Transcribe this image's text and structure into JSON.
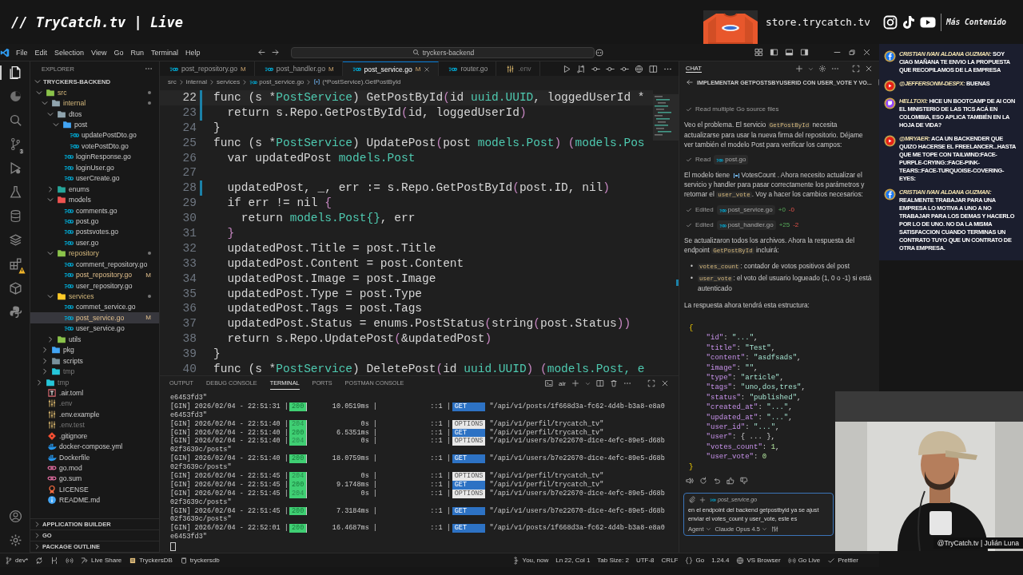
{
  "overlay": {
    "title": "// TryCatch.tv | Live",
    "store": "store.trycatch.tv",
    "more": "Más Contenido"
  },
  "window": {
    "menu": [
      "File",
      "Edit",
      "Selection",
      "View",
      "Go",
      "Run",
      "Terminal",
      "Help"
    ],
    "search": "tryckers-backend"
  },
  "activity_bar": [
    {
      "kind": "files",
      "selected": true,
      "warning": false
    },
    {
      "kind": "pie",
      "selected": false,
      "warning": false
    },
    {
      "kind": "search",
      "selected": false,
      "warning": false
    },
    {
      "kind": "branch",
      "selected": false,
      "badge": "3",
      "warning": false
    },
    {
      "kind": "debug",
      "selected": false,
      "warning": false
    },
    {
      "kind": "flask",
      "selected": false,
      "warning": false
    },
    {
      "kind": "database",
      "selected": false,
      "warning": false
    },
    {
      "kind": "layers",
      "selected": false,
      "warning": false
    },
    {
      "kind": "extensions",
      "selected": false,
      "warning": true
    },
    {
      "kind": "package",
      "selected": false,
      "warning": false
    },
    {
      "kind": "python",
      "selected": false,
      "warning": false
    }
  ],
  "activity_bottom": [
    {
      "kind": "account"
    },
    {
      "kind": "settings"
    }
  ],
  "explorer": {
    "title": "EXPLORER",
    "root": "TRYCKERS-BACKEND",
    "tree": [
      {
        "name": "src",
        "kind": "folder",
        "color": "#8bc34a",
        "expanded": true,
        "dot": true,
        "ignored": false,
        "selected": false,
        "children": [
          {
            "name": "internal",
            "kind": "folder",
            "color": "#90a4ae",
            "expanded": true,
            "dot": true,
            "ignored": false,
            "selected": false,
            "children": [
              {
                "name": "dtos",
                "kind": "folder",
                "color": "#90a4ae",
                "expanded": true,
                "dot": false,
                "ignored": false,
                "selected": false,
                "children": [
                  {
                    "name": "post",
                    "kind": "folder",
                    "color": "#42a5f5",
                    "expanded": true,
                    "dot": false,
                    "ignored": false,
                    "selected": false,
                    "children": [
                      {
                        "name": "updatePostDto.go",
                        "kind": "go",
                        "dot": false,
                        "ignored": false,
                        "selected": false
                      },
                      {
                        "name": "votePostDto.go",
                        "kind": "go",
                        "dot": false,
                        "ignored": false,
                        "selected": false
                      }
                    ]
                  },
                  {
                    "name": "loginResponse.go",
                    "kind": "go",
                    "dot": false,
                    "ignored": false,
                    "selected": false
                  },
                  {
                    "name": "loginUser.go",
                    "kind": "go",
                    "dot": false,
                    "ignored": false,
                    "selected": false
                  },
                  {
                    "name": "userCreate.go",
                    "kind": "go",
                    "dot": false,
                    "ignored": false,
                    "selected": false
                  }
                ]
              },
              {
                "name": "enums",
                "kind": "folder",
                "color": "#26a69a",
                "expanded": false,
                "dot": false,
                "ignored": false,
                "selected": false
              },
              {
                "name": "models",
                "kind": "folder",
                "color": "#ef5350",
                "expanded": true,
                "dot": false,
                "ignored": false,
                "selected": false,
                "children": [
                  {
                    "name": "comments.go",
                    "kind": "go",
                    "dot": false,
                    "ignored": false,
                    "selected": false
                  },
                  {
                    "name": "post.go",
                    "kind": "go",
                    "dot": false,
                    "ignored": false,
                    "selected": false
                  },
                  {
                    "name": "postsvotes.go",
                    "kind": "go",
                    "dot": false,
                    "ignored": false,
                    "selected": false
                  },
                  {
                    "name": "user.go",
                    "kind": "go",
                    "dot": false,
                    "ignored": false,
                    "selected": false
                  }
                ]
              },
              {
                "name": "repository",
                "kind": "folder",
                "color": "#8bc34a",
                "expanded": true,
                "dot": true,
                "ignored": false,
                "selected": false,
                "children": [
                  {
                    "name": "comment_repository.go",
                    "kind": "go",
                    "dot": false,
                    "ignored": false,
                    "selected": false
                  },
                  {
                    "name": "post_repository.go",
                    "kind": "go",
                    "badge": "M",
                    "dot": false,
                    "ignored": false,
                    "selected": false
                  },
                  {
                    "name": "user_repository.go",
                    "kind": "go",
                    "dot": false,
                    "ignored": false,
                    "selected": false
                  }
                ]
              },
              {
                "name": "services",
                "kind": "folder",
                "color": "#ffca28",
                "expanded": true,
                "dot": true,
                "ignored": false,
                "selected": false,
                "children": [
                  {
                    "name": "commet_service.go",
                    "kind": "go",
                    "dot": false,
                    "ignored": false,
                    "selected": false
                  },
                  {
                    "name": "post_service.go",
                    "kind": "go",
                    "badge": "M",
                    "dot": false,
                    "ignored": false,
                    "selected": true
                  },
                  {
                    "name": "user_service.go",
                    "kind": "go",
                    "dot": false,
                    "ignored": false,
                    "selected": false
                  }
                ]
              },
              {
                "name": "utils",
                "kind": "folder",
                "color": "#8bc34a",
                "expanded": false,
                "dot": false,
                "ignored": false,
                "selected": false
              }
            ]
          },
          {
            "name": "pkg",
            "kind": "folder",
            "color": "#42a5f5",
            "expanded": false,
            "dot": false,
            "ignored": false,
            "selected": false
          },
          {
            "name": "scripts",
            "kind": "folder",
            "color": "#78909c",
            "expanded": false,
            "dot": false,
            "ignored": false,
            "selected": false
          },
          {
            "name": "tmp",
            "kind": "folder",
            "color": "#26c6da",
            "expanded": false,
            "dot": false,
            "ignored": true,
            "selected": false
          }
        ]
      },
      {
        "name": "tmp",
        "kind": "folder",
        "color": "#26c6da",
        "expanded": false,
        "dot": false,
        "ignored": true,
        "selected": false
      },
      {
        "name": ".air.toml",
        "kind": "toml",
        "dot": false,
        "ignored": false,
        "selected": false
      },
      {
        "name": ".env",
        "kind": "env",
        "dot": false,
        "ignored": true,
        "selected": false
      },
      {
        "name": ".env.example",
        "kind": "env",
        "dot": false,
        "ignored": false,
        "selected": false
      },
      {
        "name": ".env.test",
        "kind": "env",
        "dot": false,
        "ignored": true,
        "selected": false
      },
      {
        "name": ".gitignore",
        "kind": "git",
        "dot": false,
        "ignored": false,
        "selected": false
      },
      {
        "name": "docker-compose.yml",
        "kind": "docker",
        "dot": false,
        "ignored": false,
        "selected": false
      },
      {
        "name": "Dockerfile",
        "kind": "docker",
        "dot": false,
        "ignored": false,
        "selected": false
      },
      {
        "name": "go.mod",
        "kind": "gomod",
        "dot": false,
        "ignored": false,
        "selected": false
      },
      {
        "name": "go.sum",
        "kind": "gomod",
        "dot": false,
        "ignored": false,
        "selected": false
      },
      {
        "name": "LICENSE",
        "kind": "license",
        "dot": false,
        "ignored": false,
        "selected": false
      },
      {
        "name": "README.md",
        "kind": "readme",
        "dot": false,
        "ignored": false,
        "selected": false
      }
    ],
    "sections": [
      "APPLICATION BUILDER",
      "GO",
      "PACKAGE OUTLINE"
    ]
  },
  "editor": {
    "tabs": [
      {
        "label": "post_repository.go",
        "kind": "go",
        "badge": "M",
        "ignored": false,
        "selected": false
      },
      {
        "label": "post_handler.go",
        "kind": "go",
        "badge": "M",
        "ignored": false,
        "selected": false
      },
      {
        "label": "post_service.go",
        "kind": "go",
        "badge": "M",
        "ignored": false,
        "selected": true
      },
      {
        "label": "router.go",
        "kind": "go",
        "ignored": false,
        "selected": false
      },
      {
        "label": ".env",
        "kind": "env",
        "ignored": true,
        "selected": false
      }
    ],
    "breadcrumb": [
      "src",
      "internal",
      "services",
      "post_service.go",
      "(*PostService).GetPostById"
    ],
    "lines": [
      {
        "n": "22",
        "changed": true,
        "current": true,
        "tokens": [
          {
            "text": "func (s *",
            "kind": "plain"
          },
          {
            "text": "PostService",
            "kind": "type"
          },
          {
            "text": ") GetPostById",
            "kind": "plain"
          },
          {
            "text": "(",
            "kind": "bracket"
          },
          {
            "text": "id ",
            "kind": "plain"
          },
          {
            "text": "uuid.UUID",
            "kind": "type"
          },
          {
            "text": ", loggedUserId *",
            "kind": "plain"
          }
        ]
      },
      {
        "n": "23",
        "changed": true,
        "current": false,
        "tokens": [
          {
            "text": "  return s.Repo.GetPostById",
            "kind": "plain"
          },
          {
            "text": "(",
            "kind": "bracket"
          },
          {
            "text": "id, loggedUserId",
            "kind": "plain"
          },
          {
            "text": ")",
            "kind": "bracket"
          }
        ]
      },
      {
        "n": "24",
        "changed": false,
        "current": false,
        "tokens": [
          {
            "text": "}",
            "kind": "plain"
          }
        ]
      },
      {
        "n": "25",
        "changed": false,
        "current": false,
        "tokens": [
          {
            "text": "func (s *",
            "kind": "plain"
          },
          {
            "text": "PostService",
            "kind": "type"
          },
          {
            "text": ") UpdatePost",
            "kind": "plain"
          },
          {
            "text": "(",
            "kind": "bracket"
          },
          {
            "text": "post ",
            "kind": "plain"
          },
          {
            "text": "models.Post",
            "kind": "type"
          },
          {
            "text": ") ",
            "kind": "bracket"
          },
          {
            "text": "(",
            "kind": "bracket"
          },
          {
            "text": "models.Pos",
            "kind": "type"
          }
        ]
      },
      {
        "n": "26",
        "changed": false,
        "current": false,
        "tokens": [
          {
            "text": "  var updatedPost ",
            "kind": "plain"
          },
          {
            "text": "models.Post",
            "kind": "type"
          }
        ]
      },
      {
        "n": "27",
        "changed": false,
        "current": false
      },
      {
        "n": "28",
        "changed": true,
        "current": false,
        "tokens": [
          {
            "text": "  updatedPost, _, err := s.Repo.GetPostById",
            "kind": "plain"
          },
          {
            "text": "(",
            "kind": "bracket"
          },
          {
            "text": "post.ID, nil",
            "kind": "plain"
          },
          {
            "text": ")",
            "kind": "bracket"
          }
        ]
      },
      {
        "n": "29",
        "changed": false,
        "current": false,
        "tokens": [
          {
            "text": "  if err != nil ",
            "kind": "plain"
          },
          {
            "text": "{",
            "kind": "bracket"
          }
        ]
      },
      {
        "n": "30",
        "changed": false,
        "current": false,
        "tokens": [
          {
            "text": "    return ",
            "kind": "plain"
          },
          {
            "text": "models.Post{}",
            "kind": "type"
          },
          {
            "text": ", err",
            "kind": "plain"
          }
        ]
      },
      {
        "n": "31",
        "changed": false,
        "current": false,
        "tokens": [
          {
            "text": "  }",
            "kind": "bracket"
          }
        ]
      },
      {
        "n": "32",
        "changed": false,
        "current": false,
        "tokens": [
          {
            "text": "  updatedPost.Title = post.Title",
            "kind": "plain"
          }
        ]
      },
      {
        "n": "33",
        "changed": false,
        "current": false,
        "tokens": [
          {
            "text": "  updatedPost.Content = post.Content",
            "kind": "plain"
          }
        ]
      },
      {
        "n": "34",
        "changed": false,
        "current": false,
        "tokens": [
          {
            "text": "  updatedPost.Image = post.Image",
            "kind": "plain"
          }
        ]
      },
      {
        "n": "35",
        "changed": false,
        "current": false,
        "tokens": [
          {
            "text": "  updatedPost.Type = post.Type",
            "kind": "plain"
          }
        ]
      },
      {
        "n": "36",
        "changed": false,
        "current": false,
        "tokens": [
          {
            "text": "  updatedPost.Tags = post.Tags",
            "kind": "plain"
          }
        ]
      },
      {
        "n": "37",
        "changed": false,
        "current": false,
        "tokens": [
          {
            "text": "  updatedPost.Status = enums.PostStatus",
            "kind": "plain"
          },
          {
            "text": "(",
            "kind": "bracket"
          },
          {
            "text": "string",
            "kind": "plain"
          },
          {
            "text": "(",
            "kind": "bracket"
          },
          {
            "text": "post.Status",
            "kind": "plain"
          },
          {
            "text": "))",
            "kind": "bracket"
          }
        ]
      },
      {
        "n": "38",
        "changed": false,
        "current": false,
        "tokens": [
          {
            "text": "  return s.Repo.UpdatePost",
            "kind": "plain"
          },
          {
            "text": "(",
            "kind": "bracket"
          },
          {
            "text": "&updatedPost",
            "kind": "plain"
          },
          {
            "text": ")",
            "kind": "bracket"
          }
        ]
      },
      {
        "n": "39",
        "changed": false,
        "current": false,
        "tokens": [
          {
            "text": "}",
            "kind": "plain"
          }
        ]
      },
      {
        "n": "40",
        "changed": false,
        "current": false,
        "tokens": [
          {
            "text": "func (s *",
            "kind": "plain"
          },
          {
            "text": "PostService",
            "kind": "type"
          },
          {
            "text": ") DeletePost",
            "kind": "plain"
          },
          {
            "text": "(",
            "kind": "bracket"
          },
          {
            "text": "id ",
            "kind": "plain"
          },
          {
            "text": "uuid.UUID",
            "kind": "type"
          },
          {
            "text": ") ",
            "kind": "bracket"
          },
          {
            "text": "(",
            "kind": "bracket"
          },
          {
            "text": "models.Post, e",
            "kind": "type"
          }
        ]
      }
    ]
  },
  "panel": {
    "tabs": [
      {
        "label": "OUTPUT",
        "selected": false
      },
      {
        "label": "DEBUG CONSOLE",
        "selected": false
      },
      {
        "label": "TERMINAL",
        "selected": true
      },
      {
        "label": "PORTS",
        "selected": false
      },
      {
        "label": "POSTMAN CONSOLE",
        "selected": false
      }
    ],
    "terminal_name": "air",
    "lines": [
      {
        "kind": "wrap",
        "text": "e6453fd3\""
      },
      {
        "kind": "log",
        "lead": "[GIN] 2026/02/04 - 22:51:31 |",
        "status": "200",
        "latency": "10.0519ms |",
        "client": "::1 |",
        "method": {
          "label": "GET",
          "kind": "get"
        },
        "path": "\"/api/v1/posts/1f668d3a-fc62-4d4b-b3a8-e8a0"
      },
      {
        "kind": "wrap",
        "text": "e6453fd3\""
      },
      {
        "kind": "log",
        "lead": "[GIN] 2026/02/04 - 22:51:40 |",
        "status": "204",
        "latency": "0s |",
        "client": "::1 |",
        "method": {
          "label": "OPTIONS",
          "kind": "options"
        },
        "path": "\"/api/v1/perfil/trycatch_tv\""
      },
      {
        "kind": "log",
        "lead": "[GIN] 2026/02/04 - 22:51:40 |",
        "status": "200",
        "latency": "6.5351ms |",
        "client": "::1 |",
        "method": {
          "label": "GET",
          "kind": "get"
        },
        "path": "\"/api/v1/perfil/trycatch_tv\""
      },
      {
        "kind": "log",
        "lead": "[GIN] 2026/02/04 - 22:51:40 |",
        "status": "204",
        "latency": "0s |",
        "client": "::1 |",
        "method": {
          "label": "OPTIONS",
          "kind": "options"
        },
        "path": "\"/api/v1/users/b7e22670-d1ce-4efc-89e5-d68b"
      },
      {
        "kind": "wrap",
        "text": "02f3639c/posts\""
      },
      {
        "kind": "log",
        "lead": "[GIN] 2026/02/04 - 22:51:40 |",
        "status": "200",
        "latency": "18.0759ms |",
        "client": "::1 |",
        "method": {
          "label": "GET",
          "kind": "get"
        },
        "path": "\"/api/v1/users/b7e22670-d1ce-4efc-89e5-d68b"
      },
      {
        "kind": "wrap",
        "text": "02f3639c/posts\""
      },
      {
        "kind": "log",
        "lead": "[GIN] 2026/02/04 - 22:51:45 |",
        "status": "204",
        "latency": "0s |",
        "client": "::1 |",
        "method": {
          "label": "OPTIONS",
          "kind": "options"
        },
        "path": "\"/api/v1/perfil/trycatch_tv\""
      },
      {
        "kind": "log",
        "lead": "[GIN] 2026/02/04 - 22:51:45 |",
        "status": "200",
        "latency": "9.1748ms |",
        "client": "::1 |",
        "method": {
          "label": "GET",
          "kind": "get"
        },
        "path": "\"/api/v1/perfil/trycatch_tv\""
      },
      {
        "kind": "log",
        "lead": "[GIN] 2026/02/04 - 22:51:45 |",
        "status": "204",
        "latency": "0s |",
        "client": "::1 |",
        "method": {
          "label": "OPTIONS",
          "kind": "options"
        },
        "path": "\"/api/v1/users/b7e22670-d1ce-4efc-89e5-d68b"
      },
      {
        "kind": "wrap",
        "text": "02f3639c/posts\""
      },
      {
        "kind": "log",
        "lead": "[GIN] 2026/02/04 - 22:51:45 |",
        "status": "200",
        "latency": "7.3184ms |",
        "client": "::1 |",
        "method": {
          "label": "GET",
          "kind": "get"
        },
        "path": "\"/api/v1/users/b7e22670-d1ce-4efc-89e5-d68b"
      },
      {
        "kind": "wrap",
        "text": "02f3639c/posts\""
      },
      {
        "kind": "log",
        "lead": "[GIN] 2026/02/04 - 22:52:01 |",
        "status": "200",
        "latency": "16.4687ms |",
        "client": "::1 |",
        "method": {
          "label": "GET",
          "kind": "get"
        },
        "path": "\"/api/v1/posts/1f668d3a-fc62-4d4b-b3a8-e8a0"
      },
      {
        "kind": "wrap",
        "text": "e6453fd3\""
      },
      {
        "kind": "cursor"
      }
    ]
  },
  "chat": {
    "tab": "CHAT",
    "title": "IMPLEMENTAR GETPOSTSBYUSERID CON USER_VOTE Y VO...",
    "blocks": [
      {
        "kind": "step",
        "verb": "Read multiple Go source files"
      },
      {
        "kind": "para",
        "parts": [
          {
            "text": "Veo el problema. El servicio ",
            "code": false
          },
          {
            "text": "GetPostById",
            "code": true
          },
          {
            "text": " necesita actualizarse para usar la nueva firma del repositorio. Déjame ver también el modelo Post para verificar los campos:",
            "code": false
          }
        ]
      },
      {
        "kind": "step",
        "verb": "Read",
        "file": "post.go"
      },
      {
        "kind": "para",
        "parts": [
          {
            "text": "El modelo tiene ",
            "code": false,
            "symbol": false
          },
          {
            "text": "VotesCount",
            "code": false,
            "symbol": true
          },
          {
            "text": " . Ahora necesito actualizar el servicio y handler para pasar correctamente los parámetros y retornar el ",
            "code": false,
            "symbol": false
          },
          {
            "text": "user_vote",
            "code": true,
            "symbol": false
          },
          {
            "text": ". Voy a hacer los cambios necesarios:",
            "code": false,
            "symbol": false
          }
        ]
      },
      {
        "kind": "step",
        "verb": "Edited",
        "file": "post_service.go",
        "added": "+0",
        "removed": "-0"
      },
      {
        "kind": "step",
        "verb": "Edited",
        "file": "post_handler.go",
        "added": "+25",
        "removed": "-2"
      },
      {
        "kind": "para",
        "parts": [
          {
            "text": "Se actualizaron todos los archivos. Ahora la respuesta del endpoint ",
            "code": false
          },
          {
            "text": "GetPostById",
            "code": true
          },
          {
            "text": " incluirá:",
            "code": false
          }
        ]
      },
      {
        "kind": "bullets",
        "items": [
          {
            "marker": "•",
            "parts": [
              {
                "text": "votes_count",
                "code": true
              },
              {
                "text": ": contador de votos positivos del post",
                "code": false
              }
            ]
          },
          {
            "marker": "•",
            "parts": [
              {
                "text": "user_vote",
                "code": true
              },
              {
                "text": ": el voto del usuario logueado (1, 0 o -1) si está autenticado",
                "code": false
              }
            ]
          }
        ]
      },
      {
        "kind": "para",
        "parts": [
          {
            "text": "La respuesta ahora tendrá esta estructura:",
            "code": false
          }
        ]
      },
      {
        "kind": "code",
        "lines": [
          [
            {
              "text": "{",
              "kind": "brace"
            }
          ],
          [
            {
              "text": "    \"id\"",
              "kind": "key"
            },
            {
              "text": ": ",
              "kind": "plain"
            },
            {
              "text": "\"...\"",
              "kind": "string"
            },
            {
              "text": ",",
              "kind": "plain"
            }
          ],
          [
            {
              "text": "    \"title\"",
              "kind": "key"
            },
            {
              "text": ": ",
              "kind": "plain"
            },
            {
              "text": "\"Test\"",
              "kind": "string"
            },
            {
              "text": ",",
              "kind": "plain"
            }
          ],
          [
            {
              "text": "    \"content\"",
              "kind": "key"
            },
            {
              "text": ": ",
              "kind": "plain"
            },
            {
              "text": "\"asdfsads\"",
              "kind": "string"
            },
            {
              "text": ",",
              "kind": "plain"
            }
          ],
          [
            {
              "text": "    \"image\"",
              "kind": "key"
            },
            {
              "text": ": ",
              "kind": "plain"
            },
            {
              "text": "\"\"",
              "kind": "string"
            },
            {
              "text": ",",
              "kind": "plain"
            }
          ],
          [
            {
              "text": "    \"type\"",
              "kind": "key"
            },
            {
              "text": ": ",
              "kind": "plain"
            },
            {
              "text": "\"article\"",
              "kind": "string"
            },
            {
              "text": ",",
              "kind": "plain"
            }
          ],
          [
            {
              "text": "    \"tags\"",
              "kind": "key"
            },
            {
              "text": ": ",
              "kind": "plain"
            },
            {
              "text": "\"uno,dos,tres\"",
              "kind": "string"
            },
            {
              "text": ",",
              "kind": "plain"
            }
          ],
          [
            {
              "text": "    \"status\"",
              "kind": "key"
            },
            {
              "text": ": ",
              "kind": "plain"
            },
            {
              "text": "\"published\"",
              "kind": "string"
            },
            {
              "text": ",",
              "kind": "plain"
            }
          ],
          [
            {
              "text": "    \"created_at\"",
              "kind": "key"
            },
            {
              "text": ": ",
              "kind": "plain"
            },
            {
              "text": "\"...\"",
              "kind": "string"
            },
            {
              "text": ",",
              "kind": "plain"
            }
          ],
          [
            {
              "text": "    \"updated_at\"",
              "kind": "key"
            },
            {
              "text": ": ",
              "kind": "plain"
            },
            {
              "text": "\"...\"",
              "kind": "string"
            },
            {
              "text": ",",
              "kind": "plain"
            }
          ],
          [
            {
              "text": "    \"user_id\"",
              "kind": "key"
            },
            {
              "text": ": ",
              "kind": "plain"
            },
            {
              "text": "\"...\"",
              "kind": "string"
            },
            {
              "text": ",",
              "kind": "plain"
            }
          ],
          [
            {
              "text": "    \"user\"",
              "kind": "key"
            },
            {
              "text": ": { ... },",
              "kind": "plain"
            }
          ],
          [
            {
              "text": "    \"votes_count\"",
              "kind": "key"
            },
            {
              "text": ": ",
              "kind": "plain"
            },
            {
              "text": "1",
              "kind": "number"
            },
            {
              "text": ",",
              "kind": "plain"
            }
          ],
          [
            {
              "text": "    \"user_vote\"",
              "kind": "key"
            },
            {
              "text": ": ",
              "kind": "plain"
            },
            {
              "text": "0",
              "kind": "number"
            }
          ],
          [
            {
              "text": "}",
              "kind": "brace"
            }
          ]
        ]
      }
    ],
    "input": {
      "attachment": "post_service.go",
      "lines": [
        "en el endpoint del backend getpostbyid ya se ajust",
        "enviar el votes_count y user_vote, este es"
      ],
      "mode": "Agent",
      "model": "Claude Opus 4.5"
    }
  },
  "status_bar": {
    "left": [
      {
        "kind": "branch",
        "label": "dev*"
      },
      {
        "kind": "sync"
      },
      {
        "kind": "graph"
      },
      {
        "kind": "broadcast"
      },
      {
        "kind": "share",
        "label": "Live Share"
      },
      {
        "kind": "db",
        "label": "TryckersDB"
      },
      {
        "kind": "cylinder",
        "label": "tryckersdb"
      }
    ],
    "right": [
      {
        "kind": "git",
        "label": "You, now"
      },
      {
        "label": "Ln 22, Col 1"
      },
      {
        "label": "Tab Size: 2"
      },
      {
        "label": "UTF-8"
      },
      {
        "label": "CRLF"
      },
      {
        "kind": "braces",
        "label": "Go"
      },
      {
        "label": "1.24.4"
      },
      {
        "kind": "globe",
        "label": "VS Browser"
      },
      {
        "kind": "broadcast",
        "label": "Go Live"
      },
      {
        "kind": "check",
        "label": "Prettier"
      }
    ]
  },
  "live_chat": [
    {
      "kind": "facebook",
      "author": "CRISTIAN IVAN ALDANA GUZMAN:",
      "message": "SOY CIAG MAÑANA TE ENVIO LA PROPUESTA QUE RECOPILAMOS DE LA EMPRESA"
    },
    {
      "kind": "youtube",
      "author": "@JEFFERSONM-DESPX:",
      "message": "BUENAS"
    },
    {
      "kind": "twitch",
      "author": "HELLTOXI:",
      "message": "HICE UN BOOTCAMP DE AI CON EL MINISTERIO DE LAS TICS ACÁ EN COLOMBIA, ESO APLICA TAMBIÉN EN LA HOJA DE VIDA?"
    },
    {
      "kind": "youtube",
      "author": "@MRYAER:",
      "message": "ACA UN BACKENDER QUE QUIZO HACERSE EL FREELANCER...HASTA QUE ME TOPE CON TAILWIND:FACE-PURPLE-CRYING::FACE-PINK-TEARS::FACE-TURQUOISE-COVERING-EYES:"
    },
    {
      "kind": "facebook",
      "author": "CRISTIAN IVAN ALDANA GUZMAN:",
      "message": "REALMENTE TRABAJAR PARA UNA EMPRESA LO MOTIVA A UNO A NO TRABAJAR PARA LOS DEMAS Y HACERLO POR LO DE UNO. NO DA LA MISMA SATISFACCION CUANDO TERMINAS UN CONTRATO TUYO QUE UN CONTRATO DE OTRA EMPRESA."
    }
  ],
  "webcam": {
    "kind": "picture",
    "caption": "@TryCatch.tv | Julián Luna"
  }
}
